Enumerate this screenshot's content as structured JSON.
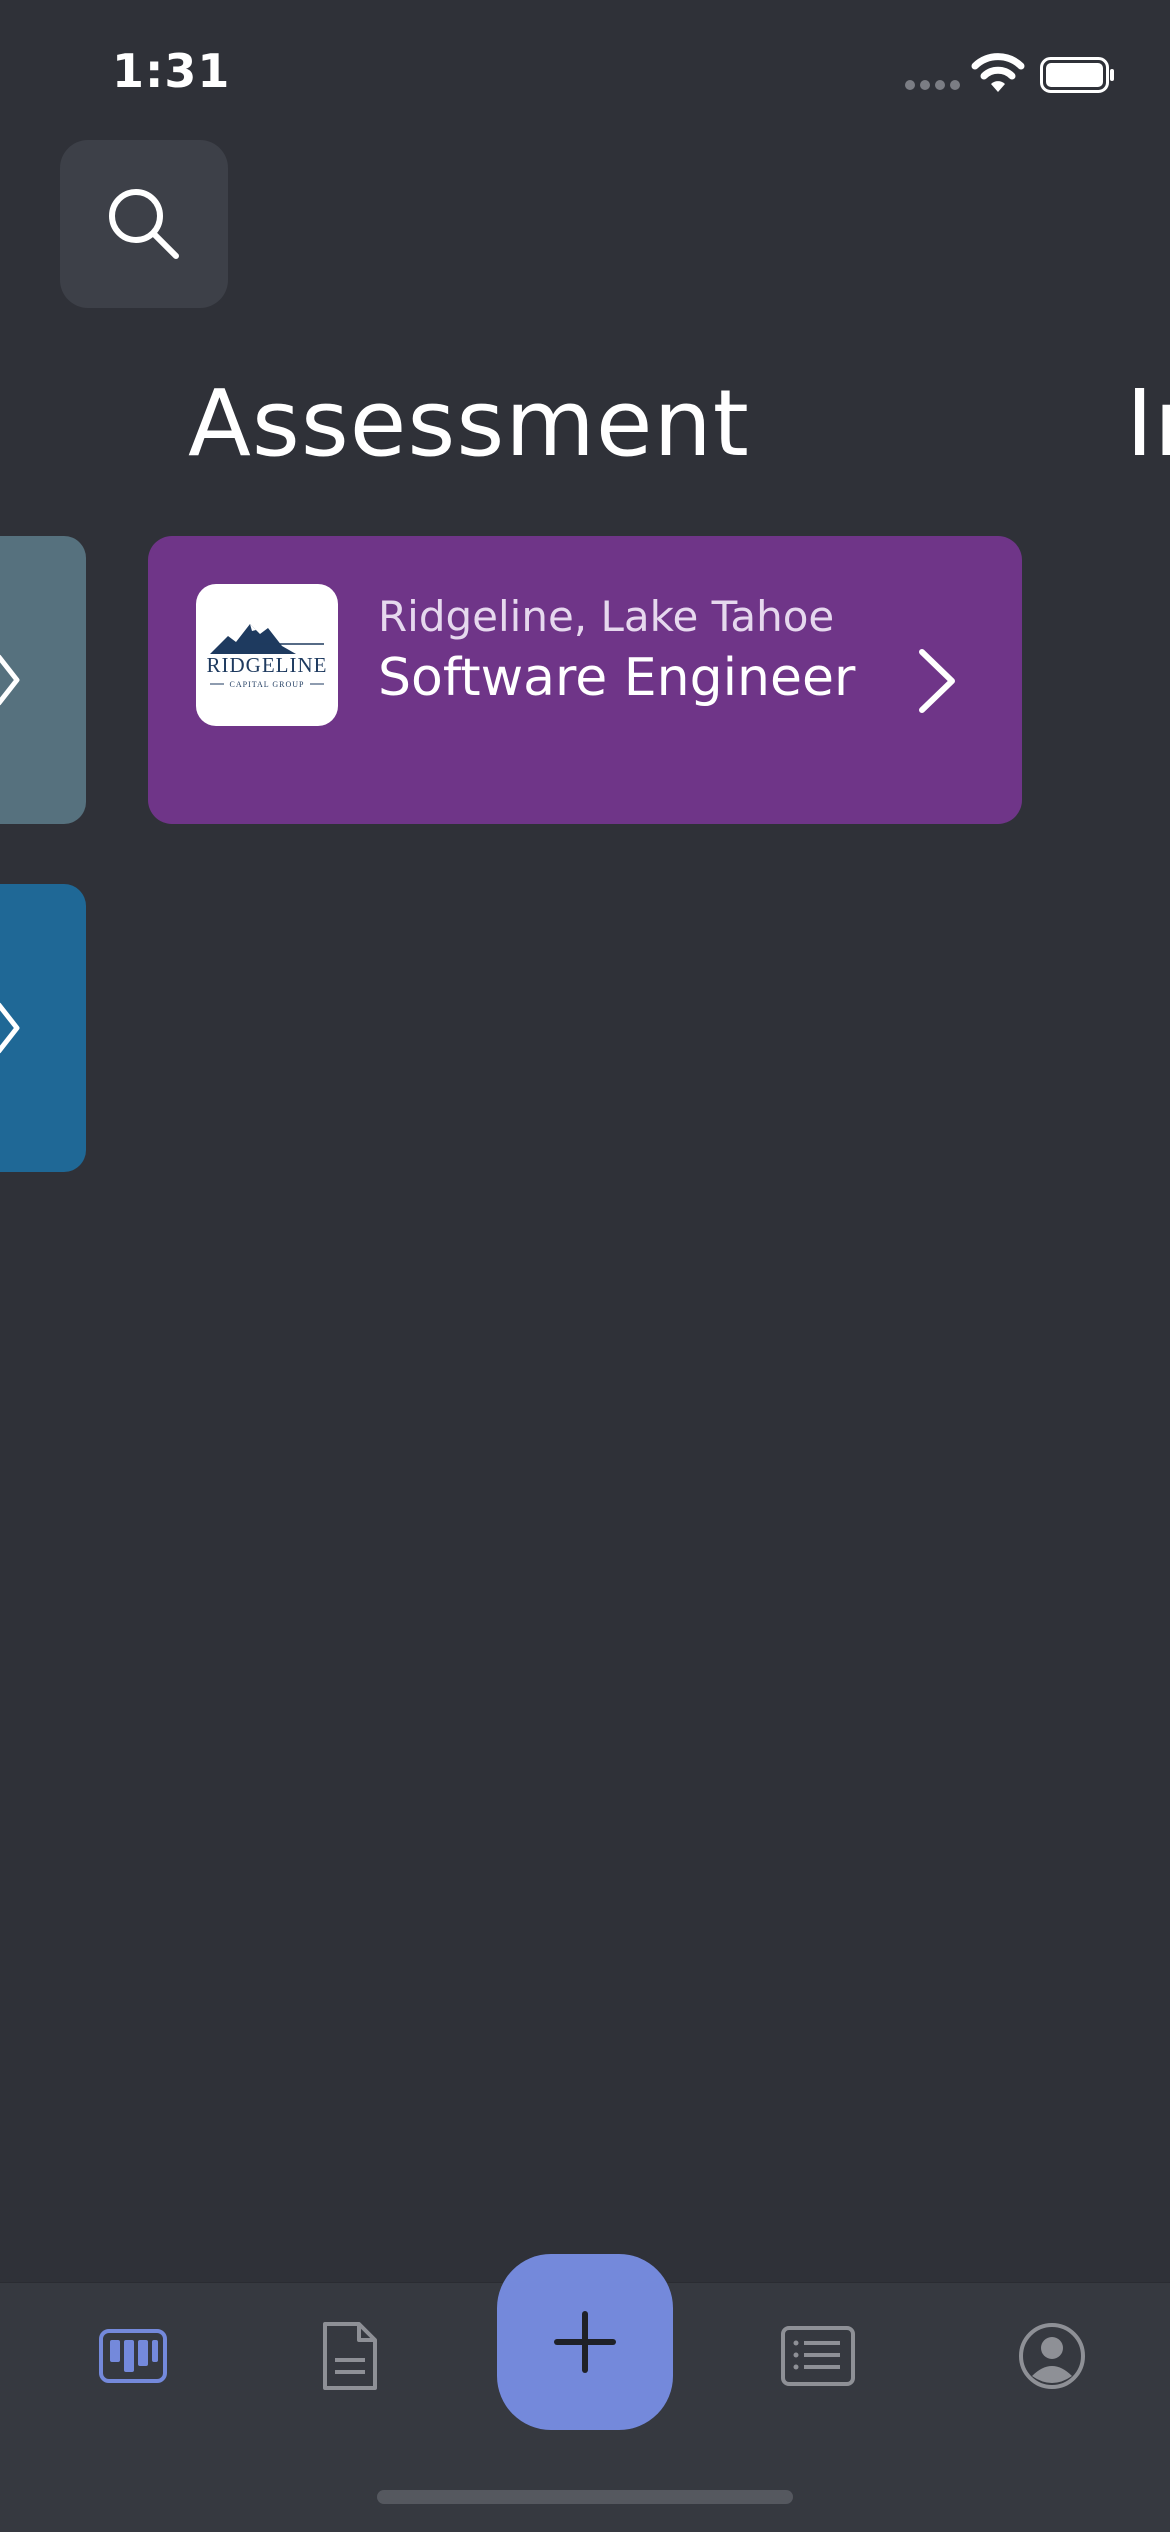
{
  "status_bar": {
    "time": "1:31",
    "icons": [
      "cellular-signal-icon",
      "wifi-icon",
      "battery-icon"
    ]
  },
  "search": {
    "icon": "search-icon"
  },
  "board": {
    "columns": [
      {
        "title": "Assessment"
      },
      {
        "title": "In"
      }
    ],
    "cards": [
      {
        "company": "RIDGELINE",
        "company_tagline": "CAPITAL GROUP",
        "location": "Ridgeline, Lake Tahoe",
        "role": "Software Engineer",
        "color": "#6f3588"
      }
    ],
    "partial_left_cards": [
      {
        "color": "#56717e"
      },
      {
        "color": "#1f6896"
      }
    ]
  },
  "tab_bar": {
    "items": [
      {
        "name": "board-tab",
        "icon": "kanban-board-icon",
        "active": true
      },
      {
        "name": "documents-tab",
        "icon": "document-icon",
        "active": false
      },
      {
        "name": "add-button",
        "icon": "plus-icon"
      },
      {
        "name": "list-tab",
        "icon": "list-icon",
        "active": false
      },
      {
        "name": "profile-tab",
        "icon": "profile-icon",
        "active": false
      }
    ],
    "accent": "#7489db"
  }
}
